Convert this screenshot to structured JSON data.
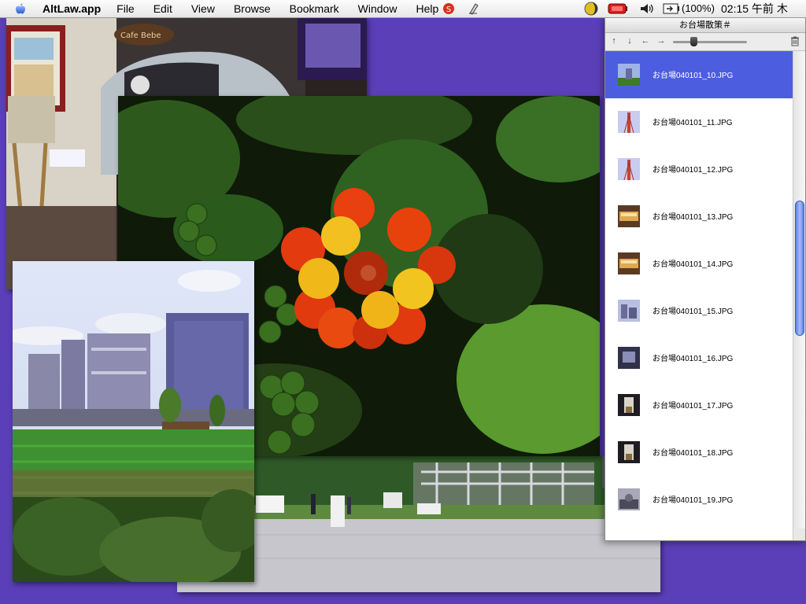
{
  "menubar": {
    "app_name": "AltLaw.app",
    "menus": [
      "File",
      "Edit",
      "View",
      "Browse",
      "Bookmark",
      "Window",
      "Help"
    ],
    "battery": "(100%)",
    "clock": "02:15 午前 木",
    "icons": [
      "apple-icon",
      "app-red-icon",
      "script-icon",
      "moon-icon",
      "battery-red-icon",
      "speaker-icon",
      "power-icon"
    ]
  },
  "window": {
    "title": "お台場散策＃",
    "toolbar_icons": [
      "sort-up-icon",
      "sort-down-icon",
      "back-icon",
      "forward-icon",
      "zoom-slider",
      "trash-icon"
    ],
    "zoom_level": 0.28,
    "selected_index": 0,
    "accent_color": "#4c5edf",
    "items": [
      {
        "name": "お台場040101_10.JPG",
        "thumb": "blue"
      },
      {
        "name": "お台場040101_11.JPG",
        "thumb": "tower"
      },
      {
        "name": "お台場040101_12.JPG",
        "thumb": "tower"
      },
      {
        "name": "お台場040101_13.JPG",
        "thumb": "shop"
      },
      {
        "name": "お台場040101_14.JPG",
        "thumb": "shop"
      },
      {
        "name": "お台場040101_15.JPG",
        "thumb": "city"
      },
      {
        "name": "お台場040101_16.JPG",
        "thumb": "dark"
      },
      {
        "name": "お台場040101_17.JPG",
        "thumb": "night"
      },
      {
        "name": "お台場040101_18.JPG",
        "thumb": "night"
      },
      {
        "name": "お台場040101_19.JPG",
        "thumb": "room"
      }
    ]
  },
  "photos": [
    "station-interior-photo",
    "flower-photo",
    "city-field-photo",
    "park-photo"
  ],
  "desktop_color": "#5a3fb8"
}
